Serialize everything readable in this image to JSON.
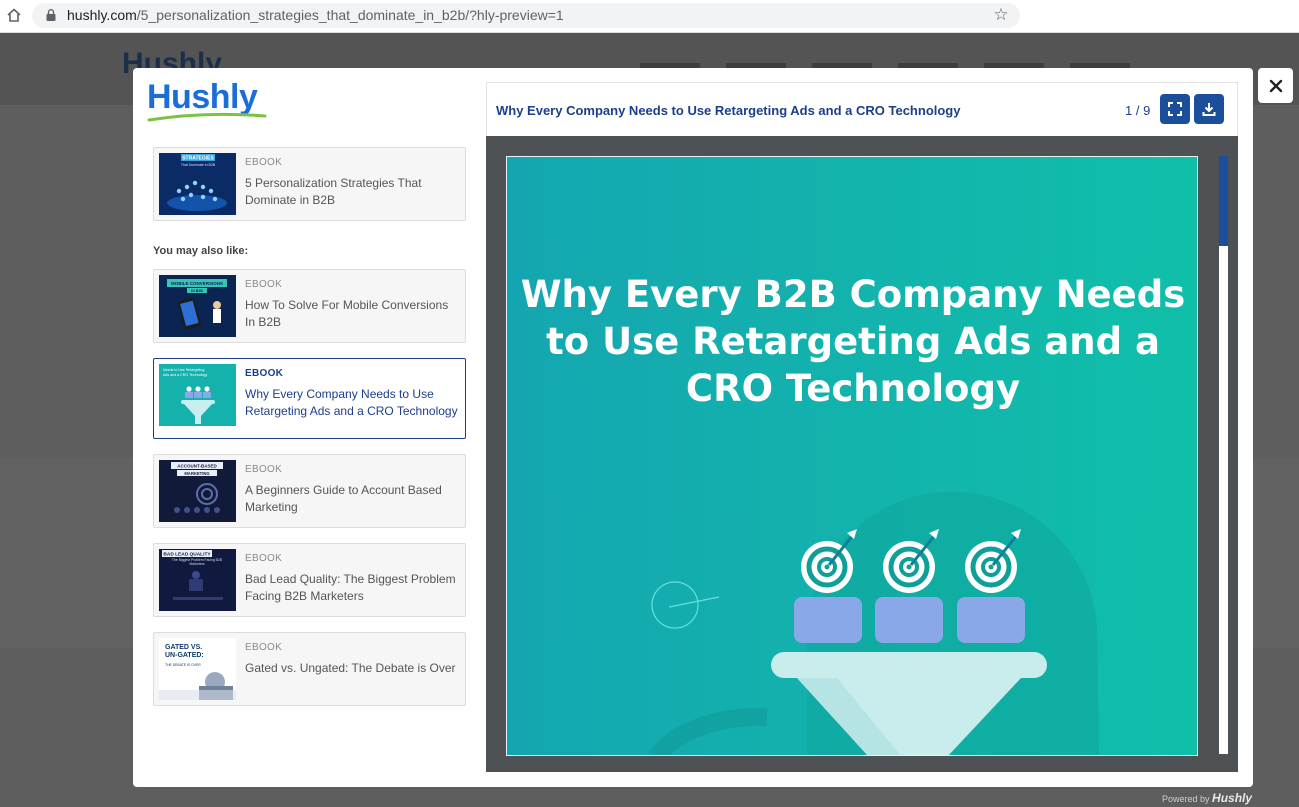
{
  "browser": {
    "url_host": "hushly.com",
    "url_path": "/5_personalization_strategies_that_dominate_in_b2b/?hly-preview=1"
  },
  "background_site": {
    "logo_text": "Hushly"
  },
  "modal": {
    "logo_text": "Hushly",
    "current_item": {
      "type": "EBOOK",
      "title": "5 Personalization Strategies That Dominate in B2B",
      "thumb_text": "STRATEGIES",
      "thumb_subtext": "That Dominate in B2B"
    },
    "also_like_label": "You may also like:",
    "recommendations": [
      {
        "type": "EBOOK",
        "title": "How To Solve For Mobile Conversions In B2B",
        "thumb_text": "MOBILE CONVERSIONS",
        "thumb_subtext": "IN B2B"
      },
      {
        "type": "EBOOK",
        "title": "Why Every Company Needs to Use Retargeting Ads and a CRO Technology",
        "thumb_text": "Needs to Use Retargeting",
        "thumb_subtext": "Ads and a CRO Technology"
      },
      {
        "type": "EBOOK",
        "title": "A Beginners Guide to Account Based Marketing",
        "thumb_text": "ACCOUNT-BASED",
        "thumb_subtext": "MARKETING"
      },
      {
        "type": "EBOOK",
        "title": "Bad Lead Quality: The Biggest Problem Facing B2B Marketers",
        "thumb_text": "BAD LEAD QUALITY",
        "thumb_subtext": "The Biggest Problem Facing B2B Marketers"
      },
      {
        "type": "EBOOK",
        "title": "Gated vs. Ungated: The Debate is Over",
        "thumb_text": "GATED VS. UN-GATED:",
        "thumb_subtext": "THE DEBATE IS OVER"
      }
    ],
    "active_index": 1,
    "viewer": {
      "title": "Why Every Company Needs to Use Retargeting Ads and a CRO Technology",
      "page_indicator": "1 / 9",
      "page_heading": "Why Every B2B Company Needs to Use Retargeting Ads and a CRO Technology",
      "scroll_fraction": 0.15
    },
    "close_icon": "close-icon",
    "fullscreen_icon": "fullscreen-icon",
    "download_icon": "download-icon"
  },
  "footer": {
    "powered_label": "Powered by",
    "powered_brand": "Hushly"
  },
  "colors": {
    "brand_blue": "#1a6ed8",
    "accent_navy": "#1b3e8e",
    "button_blue": "#1b4f9c",
    "page_teal": "#13b3ad"
  }
}
